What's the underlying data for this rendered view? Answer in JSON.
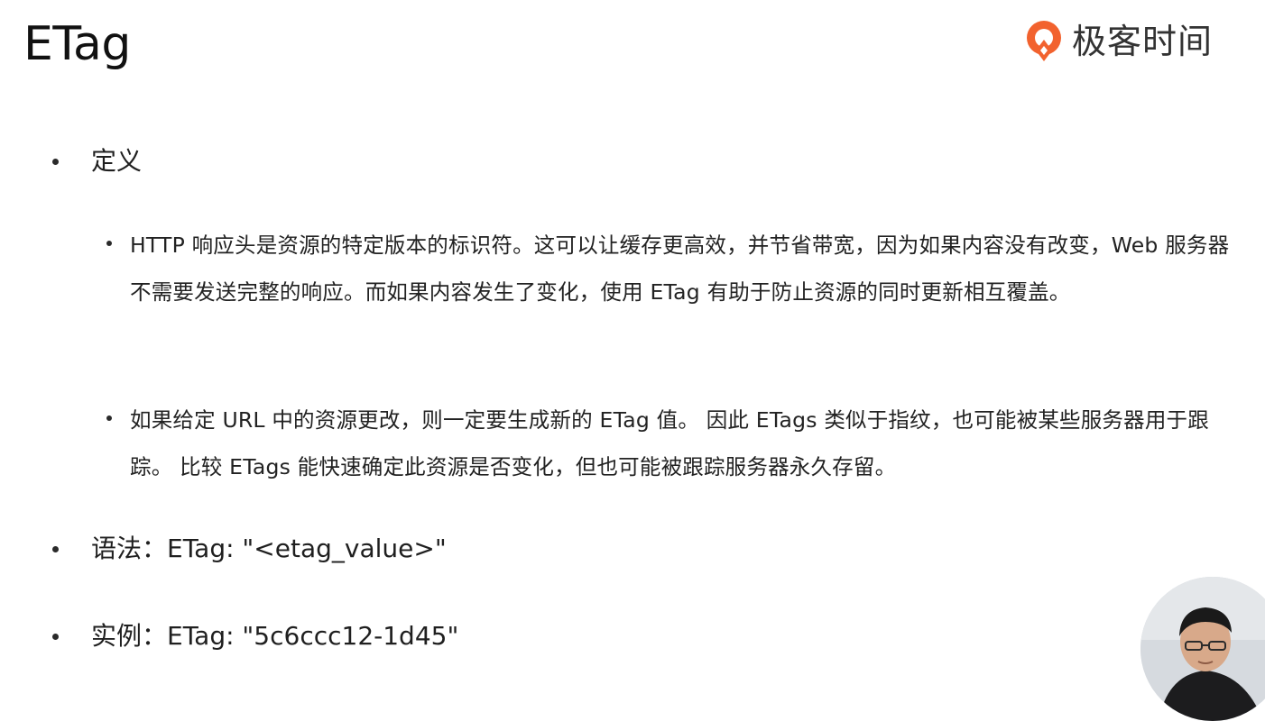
{
  "slide": {
    "title": "ETag"
  },
  "logo": {
    "text": "极客时间",
    "icon": "geektime-logo-icon",
    "accent_color": "#f2622e"
  },
  "bullets": {
    "definition": {
      "label": "定义",
      "items": [
        "HTTP 响应头是资源的特定版本的标识符。这可以让缓存更高效，并节省带宽，因为如果内容没有改变，Web 服务器不需要发送完整的响应。而如果内容发生了变化，使用 ETag 有助于防止资源的同时更新相互覆盖。",
        "如果给定 URL 中的资源更改，则一定要生成新的 ETag 值。 因此 ETags 类似于指纹，也可能被某些服务器用于跟踪。 比较 ETags 能快速确定此资源是否变化，但也可能被跟踪服务器永久存留。"
      ]
    },
    "syntax": "语法：ETag: \"<etag_value>\"",
    "example": "实例：ETag: \"5c6ccc12-1d45\""
  },
  "presenter": {
    "icon": "presenter-webcam-avatar"
  }
}
